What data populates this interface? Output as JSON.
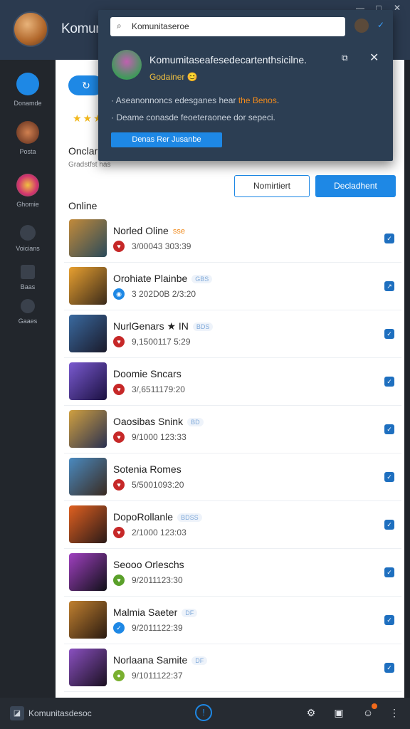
{
  "app": {
    "title": "Komunitaseroe"
  },
  "window": {
    "minimize": "—",
    "maximize": "□",
    "close": "✕"
  },
  "sidebar": {
    "items": [
      {
        "label": "Donamde",
        "icon": "sync-icon",
        "color": "#1e88e5"
      },
      {
        "label": "Posta",
        "icon": "avatar-icon",
        "color": "#b04a2a"
      },
      {
        "label": "Ghomie",
        "icon": "flower-icon",
        "color": "#d03070"
      },
      {
        "label": "Voicians",
        "icon": "headset-icon",
        "color": "#5a6270"
      },
      {
        "label": "Baas",
        "icon": "box-icon",
        "color": "#5a6270"
      },
      {
        "label": "Gaaes",
        "icon": "chat-icon",
        "color": "#5a6270"
      }
    ]
  },
  "main": {
    "pill_button": "↻",
    "stars": "★★★",
    "section_title": "Onclar",
    "section_sub": "Gradstfst has",
    "button_outline": "Nomirtiert",
    "button_solid": "Decladhent",
    "online_title": "Online"
  },
  "games": [
    {
      "name": "Norled Oline",
      "tag": "sse",
      "tag_style": "orange",
      "badge_color": "#c62828",
      "badge": "♥",
      "time": "3/00043 303:39",
      "action": "✓",
      "thumb": [
        "#c28a3a",
        "#2a4a5a"
      ]
    },
    {
      "name": "Orohiate Plainbe",
      "tag": "GBS",
      "tag_style": "blue",
      "badge_color": "#1e88e5",
      "badge": "◉",
      "time": "3 202D0B 2/3:20",
      "action": "↗",
      "thumb": [
        "#e8a030",
        "#3a2a1a"
      ]
    },
    {
      "name": "NurlGenars ★ IN",
      "tag": "BDS",
      "tag_style": "blue",
      "badge_color": "#c62828",
      "badge": "♥",
      "time": "9,1500117 5:29",
      "action": "✓",
      "thumb": [
        "#3a6aa0",
        "#1a1a2a"
      ]
    },
    {
      "name": "Doomie Sncars",
      "tag": "",
      "tag_style": "blue",
      "badge_color": "#c62828",
      "badge": "♥",
      "time": "3/,6511179:20",
      "action": "✓",
      "thumb": [
        "#7a5ad0",
        "#1a1040"
      ]
    },
    {
      "name": "Oaosibas Snink",
      "tag": "BD",
      "tag_style": "blue",
      "badge_color": "#c62828",
      "badge": "♥",
      "time": "9/1000 123:33",
      "action": "✓",
      "thumb": [
        "#d0a040",
        "#2a3050"
      ]
    },
    {
      "name": "Sotenia Romes",
      "tag": "",
      "tag_style": "orange",
      "badge_color": "#c62828",
      "badge": "♥",
      "time": "5/5001093:20",
      "action": "✓",
      "thumb": [
        "#4a8ac0",
        "#3a2a20"
      ]
    },
    {
      "name": "DopoRollanle",
      "tag": "BDSS",
      "tag_style": "blue",
      "badge_color": "#c62828",
      "badge": "♥",
      "time": "2/1000 123:03",
      "action": "✓",
      "thumb": [
        "#e06020",
        "#2a1a18"
      ]
    },
    {
      "name": "Seooo Orleschs",
      "tag": "",
      "tag_style": "blue",
      "badge_color": "#5aa02a",
      "badge": "♥",
      "time": "9/2011123:30",
      "action": "✓",
      "thumb": [
        "#a040c0",
        "#101018"
      ]
    },
    {
      "name": "Malmia Saeter",
      "tag": "DF",
      "tag_style": "blue",
      "badge_color": "#1e88e5",
      "badge": "✓",
      "time": "9/2011122:39",
      "action": "✓",
      "thumb": [
        "#c08030",
        "#2a1a10"
      ]
    },
    {
      "name": "Norlaana Samite",
      "tag": "DF",
      "tag_style": "blue",
      "badge_color": "#7ab030",
      "badge": "●",
      "time": "9/1011122:37",
      "action": "✓",
      "thumb": [
        "#8a50c0",
        "#1a1020"
      ]
    }
  ],
  "bottombar": {
    "logo": "◪",
    "title": "Komunitasdesoc",
    "center_icon": "!",
    "icons": [
      "⚙",
      "▣",
      "☺",
      "⋮"
    ]
  },
  "popup": {
    "search_value": "Komunitaseroe",
    "title": "Komumitaseafesedecartenthsicilne.",
    "subtitle": "Godainer 😊",
    "line1_prefix": "· Aseanonnoncs edesganes hear ",
    "line1_highlight": "the Benos",
    "line1_suffix": ".",
    "line2": "· Deame conasde feoeteraonee dor sepeci.",
    "button": "Denas Rer Jusanbe",
    "copy_icon": "⧉",
    "close_icon": "✕",
    "check_icon": "✓"
  }
}
